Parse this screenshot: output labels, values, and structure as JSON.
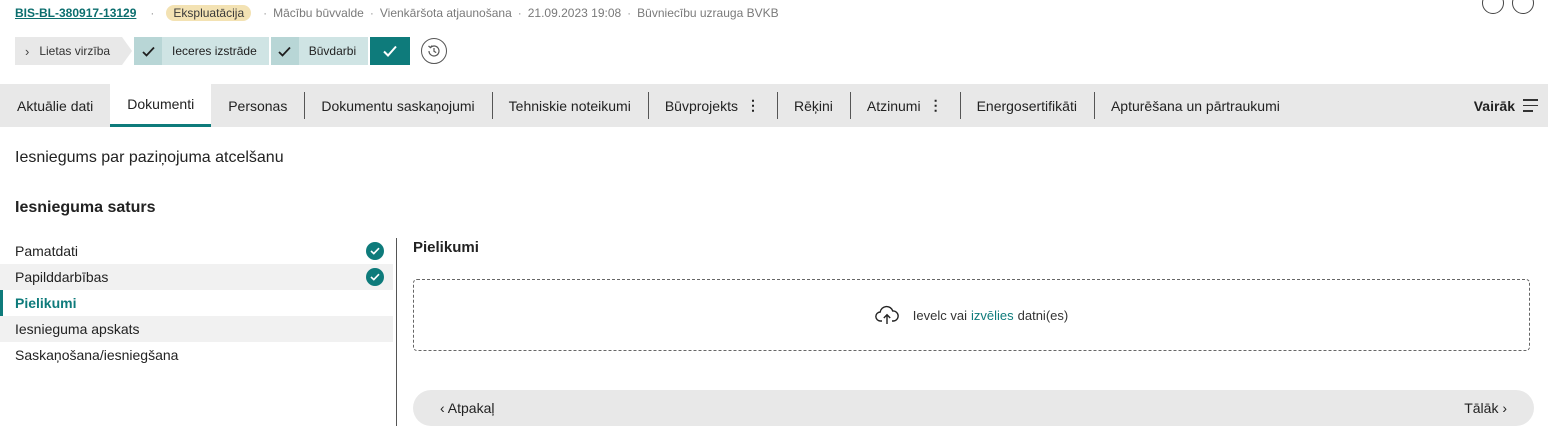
{
  "header": {
    "case_id": "BIS-BL-380917-13129",
    "status": "Ekspluatācija",
    "meta": [
      "Mācību būvvalde",
      "Vienkāršota atjaunošana",
      "21.09.2023 19:08",
      "Būvniecību uzrauga BVKB"
    ]
  },
  "progress": {
    "lietas_virziba": "Lietas virzība",
    "steps": [
      "Ieceres izstrāde",
      "Būvdarbi"
    ]
  },
  "tabs": [
    {
      "label": "Aktuālie dati"
    },
    {
      "label": "Dokumenti"
    },
    {
      "label": "Personas"
    },
    {
      "label": "Dokumentu saskaņojumi"
    },
    {
      "label": "Tehniskie noteikumi"
    },
    {
      "label": "Būvprojekts"
    },
    {
      "label": "Rēķini"
    },
    {
      "label": "Atzinumi"
    },
    {
      "label": "Energosertifikāti"
    },
    {
      "label": "Apturēšana un pārtraukumi"
    }
  ],
  "more_label": "Vairāk",
  "document_title": "Iesniegums par paziņojuma atcelšanu",
  "content_title": "Iesnieguma saturs",
  "nav": [
    {
      "label": "Pamatdati"
    },
    {
      "label": "Papilddarbības"
    },
    {
      "label": "Pielikumi"
    },
    {
      "label": "Iesnieguma apskats"
    },
    {
      "label": "Saskaņošana/iesniegšana"
    }
  ],
  "panel": {
    "title": "Pielikumi",
    "drop_prefix": "Ievelc vai",
    "drop_link": "izvēlies",
    "drop_suffix": "datni(es)"
  },
  "footer": {
    "back": "Atpakaļ",
    "next": "Tālāk"
  },
  "colors": {
    "accent": "#0e7b7b",
    "status_badge": "#f3e2b3",
    "tab_bar": "#e8e8e8"
  }
}
